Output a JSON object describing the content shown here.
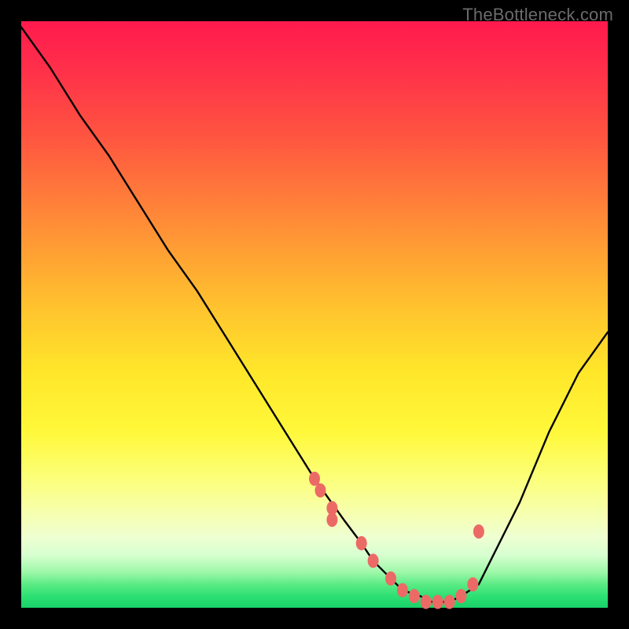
{
  "watermark": "TheBottleneck.com",
  "colors": {
    "curve_stroke": "#000000",
    "dot_fill": "#ec6a66",
    "dot_stroke": "#ec6a66"
  },
  "chart_data": {
    "type": "line",
    "title": "",
    "xlabel": "",
    "ylabel": "",
    "xlim": [
      0,
      100
    ],
    "ylim": [
      0,
      100
    ],
    "grid": false,
    "series": [
      {
        "name": "bottleneck-curve",
        "x": [
          0,
          5,
          10,
          15,
          20,
          25,
          30,
          35,
          40,
          45,
          50,
          55,
          58,
          60,
          63,
          65,
          68,
          70,
          73,
          75,
          78,
          80,
          85,
          90,
          95,
          100
        ],
        "y": [
          99,
          92,
          84,
          77,
          69,
          61,
          54,
          46,
          38,
          30,
          22,
          15,
          11,
          8,
          5,
          3,
          2,
          1,
          1,
          2,
          4,
          8,
          18,
          30,
          40,
          47
        ]
      }
    ],
    "markers": {
      "name": "highlighted-points",
      "x": [
        50,
        51,
        53,
        53,
        58,
        60,
        63,
        65,
        67,
        69,
        71,
        73,
        75,
        77,
        78
      ],
      "y": [
        22,
        20,
        17,
        15,
        11,
        8,
        5,
        3,
        2,
        1,
        1,
        1,
        2,
        4,
        13
      ]
    }
  }
}
